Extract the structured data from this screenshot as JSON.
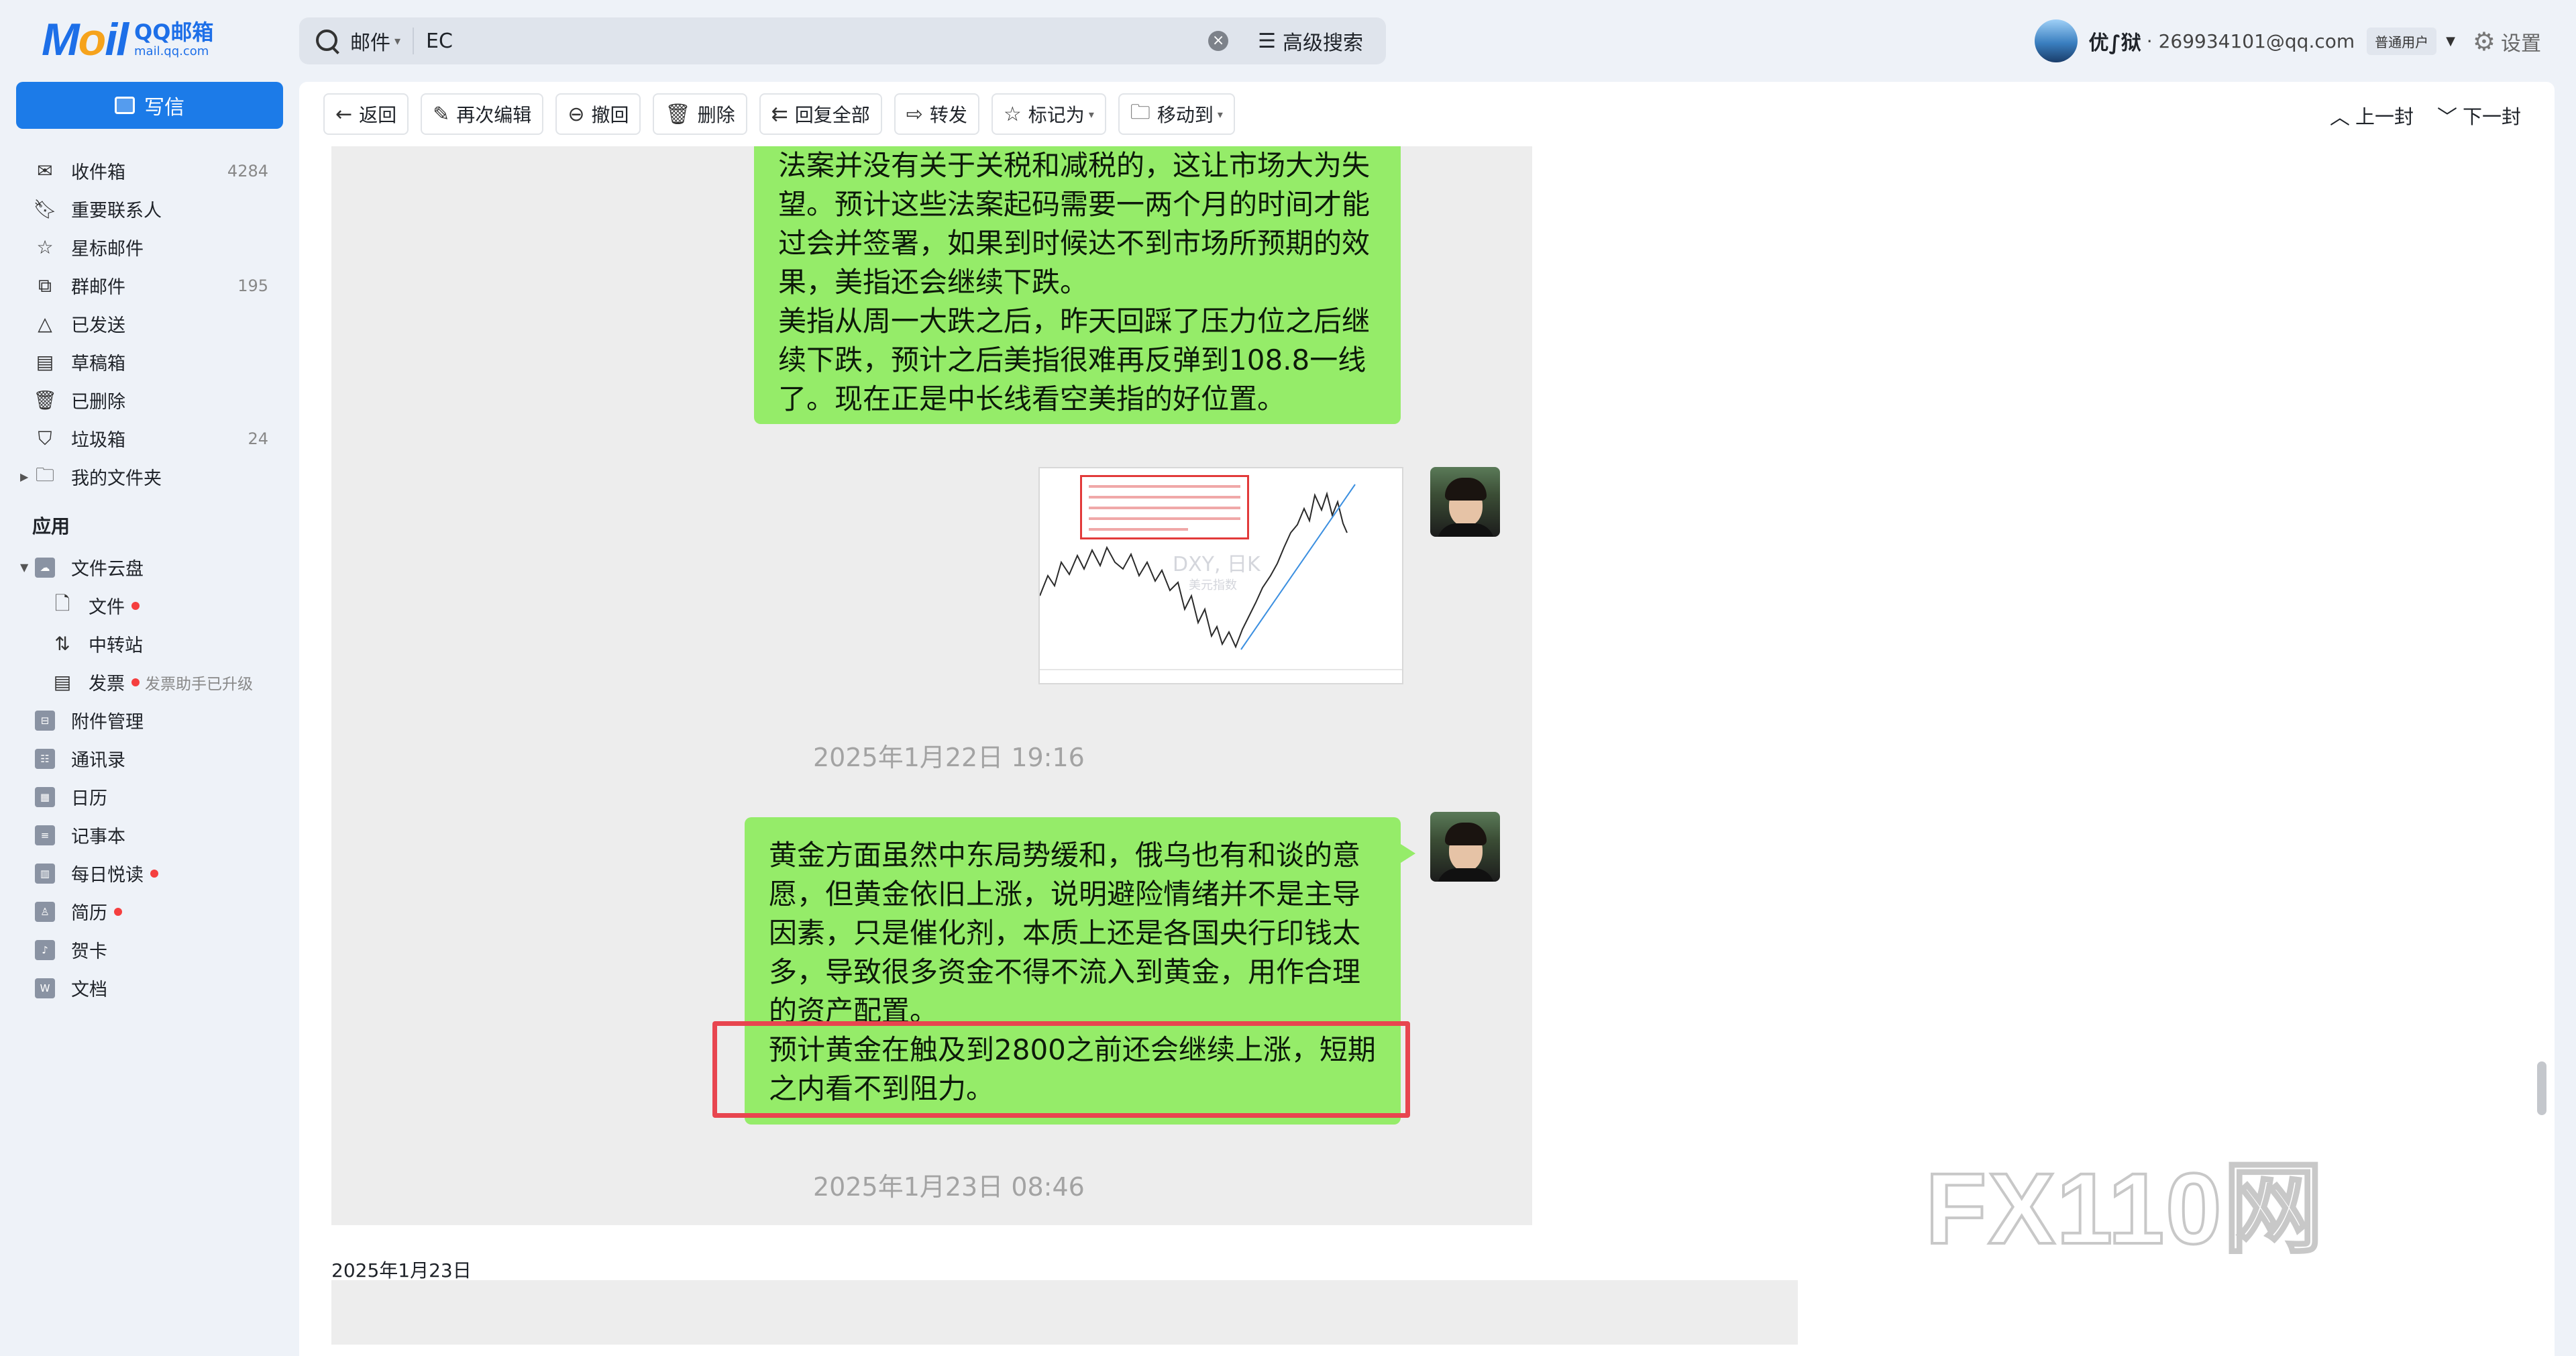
{
  "logo": {
    "mark": "MOil",
    "cn": "QQ邮箱",
    "en": "mail.qq.com"
  },
  "search": {
    "scope": "邮件",
    "query": "EC",
    "advanced": "高级搜索"
  },
  "user": {
    "name": "优∫狱",
    "email": "· 269934101@qq.com",
    "badge": "普通用户",
    "settings": "设置"
  },
  "compose": "写信",
  "nav": {
    "inbox": {
      "label": "收件箱",
      "count": "4284"
    },
    "vip": {
      "label": "重要联系人"
    },
    "starred": {
      "label": "星标邮件"
    },
    "group": {
      "label": "群邮件",
      "count": "195"
    },
    "sent": {
      "label": "已发送"
    },
    "drafts": {
      "label": "草稿箱"
    },
    "deleted": {
      "label": "已删除"
    },
    "spam": {
      "label": "垃圾箱",
      "count": "24"
    },
    "folders": {
      "label": "我的文件夹"
    }
  },
  "apps": {
    "title": "应用",
    "cloud": "文件云盘",
    "files": "文件",
    "transfer": "中转站",
    "invoice": "发票",
    "invoice_hint": "发票助手已升级",
    "attachments": "附件管理",
    "contacts": "通讯录",
    "calendar": "日历",
    "notes": "记事本",
    "daily": "每日悦读",
    "resume": "简历",
    "cards": "贺卡",
    "docs": "文档"
  },
  "toolbar": {
    "back": "返回",
    "edit": "再次编辑",
    "recall": "撤回",
    "delete": "删除",
    "reply_all": "回复全部",
    "forward": "转发",
    "mark": "标记为",
    "move": "移动到",
    "prev": "上一封",
    "next": "下一封"
  },
  "messages": {
    "bubble1": [
      "法案并没有关于关税和减税的，这让市场大为失",
      "望。预计这些法案起码需要一两个月的时间才能",
      "过会并签署，如果到时候达不到市场所预期的效",
      "果，美指还会继续下跌。",
      "美指从周一大跌之后，昨天回踩了压力位之后继",
      "续下跌，预计之后美指很难再反弹到108.8一线",
      "了。现在正是中长线看空美指的好位置。"
    ],
    "chart_watermark": "DXY, 日K",
    "chart_watermark2": "美元指数",
    "timestamp1": "2025年1月22日 19:16",
    "bubble2": [
      "黄金方面虽然中东局势缓和，俄乌也有和谈的意",
      "愿，但黄金依旧上涨，说明避险情绪并不是主导",
      "因素，只是催化剂，本质上还是各国央行印钱太",
      "多，导致很多资金不得不流入到黄金，用作合理",
      "的资产配置。",
      "预计黄金在触及到2800之前还会继续上涨，短期",
      "之内看不到阻力。"
    ],
    "timestamp2": "2025年1月23日 08:46"
  },
  "date_label": "2025年1月23日",
  "watermark": "FX110网",
  "colors": {
    "accent": "#1c7be8",
    "bubble": "#95ec69",
    "highlight": "#e8454f"
  }
}
